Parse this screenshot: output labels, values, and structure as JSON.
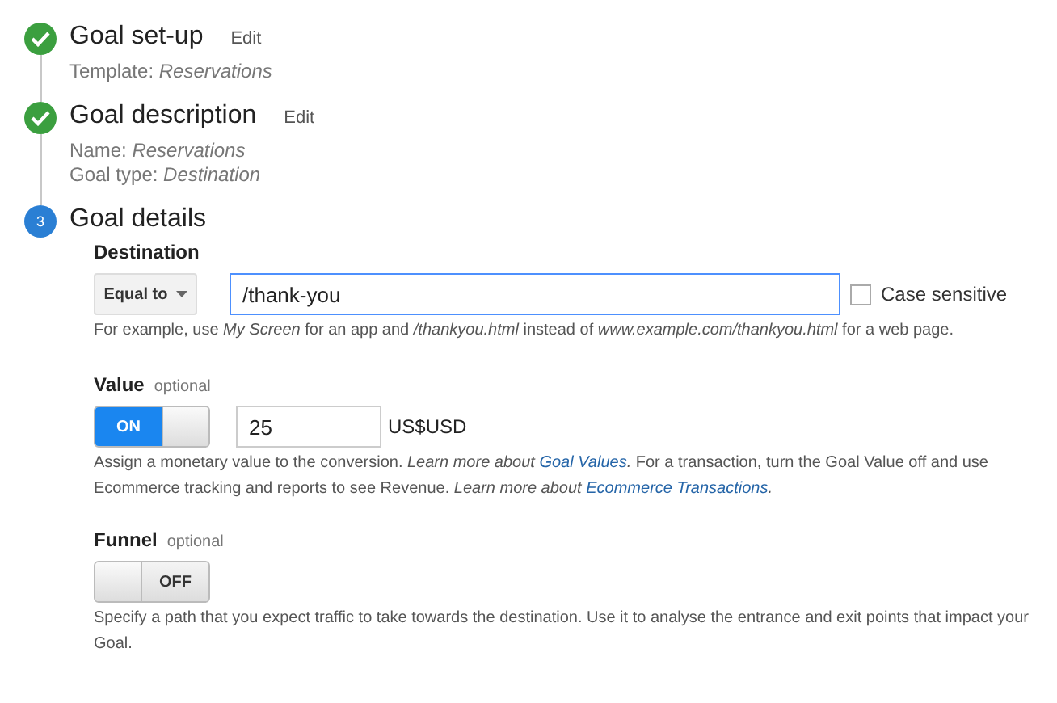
{
  "steps": [
    {
      "completed": true,
      "title": "Goal set-up",
      "edit": "Edit",
      "details": [
        {
          "label": "Template:",
          "value": "Reservations"
        }
      ]
    },
    {
      "completed": true,
      "title": "Goal description",
      "edit": "Edit",
      "details": [
        {
          "label": "Name:",
          "value": "Reservations"
        },
        {
          "label": "Goal type:",
          "value": "Destination"
        }
      ]
    },
    {
      "completed": false,
      "number": "3",
      "title": "Goal details"
    }
  ],
  "destination": {
    "label": "Destination",
    "match": "Equal to",
    "value": "/thank-you",
    "case_sensitive": {
      "label": "Case sensitive",
      "checked": false
    },
    "help": [
      {
        "kind": "plain",
        "text": "For example, use "
      },
      {
        "kind": "italic",
        "text": "My Screen"
      },
      {
        "kind": "plain",
        "text": " for an app and "
      },
      {
        "kind": "italic",
        "text": "/thankyou.html"
      },
      {
        "kind": "plain",
        "text": " instead of "
      },
      {
        "kind": "italic",
        "text": "www.example.com/thankyou.html"
      },
      {
        "kind": "plain",
        "text": " for a web page."
      }
    ]
  },
  "value": {
    "label": "Value",
    "optional": "optional",
    "toggle": {
      "on": true,
      "label": "ON"
    },
    "amount": "25",
    "currency": "US$USD",
    "help": [
      {
        "kind": "plain",
        "text": "Assign a monetary value to the conversion. "
      },
      {
        "kind": "italic",
        "text": "Learn more about "
      },
      {
        "kind": "link",
        "text": "Goal Values"
      },
      {
        "kind": "italic",
        "text": "."
      },
      {
        "kind": "plain",
        "text": " For a transaction, turn the Goal Value off and use Ecommerce tracking and reports to see Revenue. "
      },
      {
        "kind": "italic",
        "text": "Learn more about "
      },
      {
        "kind": "link",
        "text": "Ecommerce Transactions"
      },
      {
        "kind": "italic",
        "text": "."
      }
    ]
  },
  "funnel": {
    "label": "Funnel",
    "optional": "optional",
    "toggle": {
      "on": false,
      "label": "OFF"
    },
    "help": [
      {
        "kind": "plain",
        "text": "Specify a path that you expect traffic to take towards the destination. Use it to analyse the entrance and exit points that impact your Goal."
      }
    ]
  }
}
